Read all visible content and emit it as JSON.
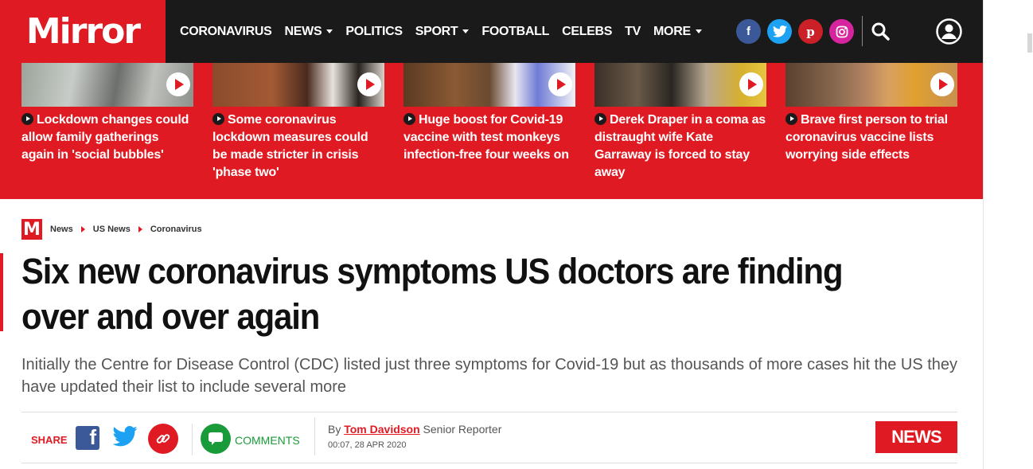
{
  "brand": {
    "logo_text": "Mirror",
    "mark": "M",
    "accent": "#e01a22",
    "dark": "#1a1a1a"
  },
  "nav": [
    {
      "label": "CORONAVIRUS",
      "dropdown": false
    },
    {
      "label": "NEWS",
      "dropdown": true
    },
    {
      "label": "POLITICS",
      "dropdown": false
    },
    {
      "label": "SPORT",
      "dropdown": true
    },
    {
      "label": "FOOTBALL",
      "dropdown": false
    },
    {
      "label": "CELEBS",
      "dropdown": false
    },
    {
      "label": "TV",
      "dropdown": false
    },
    {
      "label": "MORE",
      "dropdown": true
    }
  ],
  "social": [
    {
      "icon": "facebook-icon",
      "glyph": "f",
      "color": "#3b5998"
    },
    {
      "icon": "twitter-icon",
      "glyph": "t",
      "color": "#1da1f2"
    },
    {
      "icon": "pinterest-icon",
      "glyph": "p",
      "color": "#cb2027"
    },
    {
      "icon": "instagram-icon",
      "glyph": "◎",
      "color": "#d6249f"
    }
  ],
  "video_strip": [
    {
      "title": "Lockdown changes could allow family gatherings again in 'social bubbles'"
    },
    {
      "title": "Some coronavirus lockdown measures could be made stricter in crisis 'phase two'"
    },
    {
      "title": "Huge boost for Covid-19 vaccine with test monkeys infection-free four weeks on"
    },
    {
      "title": "Derek Draper in a coma as distraught wife Kate Garraway is forced to stay away"
    },
    {
      "title": "Brave first person to trial coronavirus vaccine lists worrying side effects"
    }
  ],
  "breadcrumb": [
    "News",
    "US News",
    "Coronavirus"
  ],
  "article": {
    "headline": "Six new coronavirus symptoms US doctors are finding over and over again",
    "standfirst": "Initially the Centre for Disease Control (CDC) listed just three symptoms for Covid-19 but as thousands of more cases hit the US they have updated their list to include several more",
    "share_label": "SHARE",
    "comments_label": "COMMENTS",
    "by_label": "By",
    "author": "Tom Davidson",
    "author_role": "Senior Reporter",
    "date": "00:07, 28 APR 2020",
    "section_button": "NEWS"
  }
}
